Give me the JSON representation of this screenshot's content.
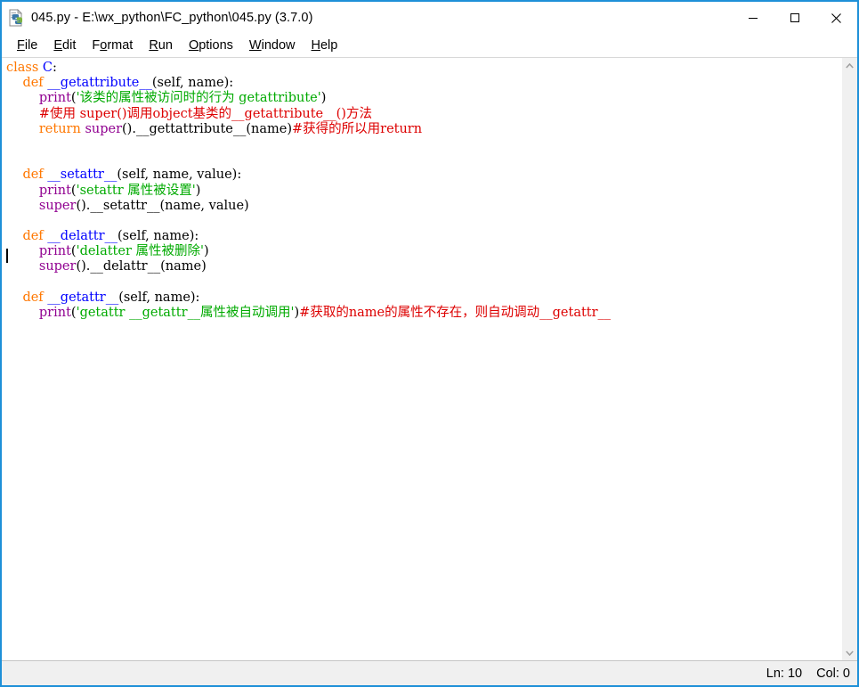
{
  "window": {
    "title": "045.py - E:\\wx_python\\FC_python\\045.py (3.7.0)",
    "icon": "python-file-icon",
    "border_color": "#1e90d8",
    "controls": {
      "minimize": "minimize-icon",
      "maximize": "maximize-icon",
      "close": "close-icon"
    }
  },
  "menubar": {
    "items": [
      {
        "label": "File",
        "accel_before": "",
        "accel": "F",
        "accel_after": "ile"
      },
      {
        "label": "Edit",
        "accel_before": "",
        "accel": "E",
        "accel_after": "dit"
      },
      {
        "label": "Format",
        "accel_before": "F",
        "accel": "o",
        "accel_after": "rmat"
      },
      {
        "label": "Run",
        "accel_before": "",
        "accel": "R",
        "accel_after": "un"
      },
      {
        "label": "Options",
        "accel_before": "",
        "accel": "O",
        "accel_after": "ptions"
      },
      {
        "label": "Window",
        "accel_before": "",
        "accel": "W",
        "accel_after": "indow"
      },
      {
        "label": "Help",
        "accel_before": "",
        "accel": "H",
        "accel_after": "elp"
      }
    ]
  },
  "editor": {
    "colors": {
      "keyword": "#ff7700",
      "definition": "#0000ff",
      "builtin": "#900090",
      "string": "#00aa00",
      "comment": "#dd0000",
      "plain": "#000000",
      "background": "#ffffff"
    },
    "caret": {
      "line": 10,
      "column": 0
    },
    "lines": [
      [
        {
          "t": "class",
          "c": "kw"
        },
        {
          "t": " ",
          "c": "pl"
        },
        {
          "t": "C",
          "c": "def"
        },
        {
          "t": ":",
          "c": "pl"
        }
      ],
      [
        {
          "t": "    ",
          "c": "pl"
        },
        {
          "t": "def",
          "c": "kw"
        },
        {
          "t": " ",
          "c": "pl"
        },
        {
          "t": "__getattribute__",
          "c": "def"
        },
        {
          "t": "(self, name):",
          "c": "pl"
        }
      ],
      [
        {
          "t": "        ",
          "c": "pl"
        },
        {
          "t": "print",
          "c": "bi"
        },
        {
          "t": "(",
          "c": "pl"
        },
        {
          "t": "'该类的属性被访问时的行为 getattribute'",
          "c": "str"
        },
        {
          "t": ")",
          "c": "pl"
        }
      ],
      [
        {
          "t": "        ",
          "c": "pl"
        },
        {
          "t": "#使用 super()调用object基类的__getattribute__()方法",
          "c": "com"
        }
      ],
      [
        {
          "t": "        ",
          "c": "pl"
        },
        {
          "t": "return",
          "c": "kw"
        },
        {
          "t": " ",
          "c": "pl"
        },
        {
          "t": "super",
          "c": "bi"
        },
        {
          "t": "().__gettattribute__(name)",
          "c": "pl"
        },
        {
          "t": "#获得的所以用return",
          "c": "com"
        }
      ],
      [],
      [],
      [
        {
          "t": "    ",
          "c": "pl"
        },
        {
          "t": "def",
          "c": "kw"
        },
        {
          "t": " ",
          "c": "pl"
        },
        {
          "t": "__setattr__",
          "c": "def"
        },
        {
          "t": "(self, name, value):",
          "c": "pl"
        }
      ],
      [
        {
          "t": "        ",
          "c": "pl"
        },
        {
          "t": "print",
          "c": "bi"
        },
        {
          "t": "(",
          "c": "pl"
        },
        {
          "t": "'setattr 属性被设置'",
          "c": "str"
        },
        {
          "t": ")",
          "c": "pl"
        }
      ],
      [
        {
          "t": "        ",
          "c": "pl"
        },
        {
          "t": "super",
          "c": "bi"
        },
        {
          "t": "().__setattr__(name, value)",
          "c": "pl"
        }
      ],
      [],
      [
        {
          "t": "    ",
          "c": "pl"
        },
        {
          "t": "def",
          "c": "kw"
        },
        {
          "t": " ",
          "c": "pl"
        },
        {
          "t": "__delattr__",
          "c": "def"
        },
        {
          "t": "(self, name):",
          "c": "pl"
        }
      ],
      [
        {
          "t": "        ",
          "c": "pl"
        },
        {
          "t": "print",
          "c": "bi"
        },
        {
          "t": "(",
          "c": "pl"
        },
        {
          "t": "'delatter 属性被删除'",
          "c": "str"
        },
        {
          "t": ")",
          "c": "pl"
        }
      ],
      [
        {
          "t": "        ",
          "c": "pl"
        },
        {
          "t": "super",
          "c": "bi"
        },
        {
          "t": "().__delattr__(name)",
          "c": "pl"
        }
      ],
      [],
      [
        {
          "t": "    ",
          "c": "pl"
        },
        {
          "t": "def",
          "c": "kw"
        },
        {
          "t": " ",
          "c": "pl"
        },
        {
          "t": "__getattr__",
          "c": "def"
        },
        {
          "t": "(self, name):",
          "c": "pl"
        }
      ],
      [
        {
          "t": "        ",
          "c": "pl"
        },
        {
          "t": "print",
          "c": "bi"
        },
        {
          "t": "(",
          "c": "pl"
        },
        {
          "t": "'getattr __getattr__属性被自动调用'",
          "c": "str"
        },
        {
          "t": ")",
          "c": "pl"
        },
        {
          "t": "#获取的name的属性不存在，则自动调动__getattr__",
          "c": "com"
        }
      ]
    ]
  },
  "scrollbar": {
    "up_arrow": "chevron-up-icon",
    "down_arrow": "chevron-down-icon"
  },
  "statusbar": {
    "line_label": "Ln: 10",
    "col_label": "Col: 0"
  }
}
